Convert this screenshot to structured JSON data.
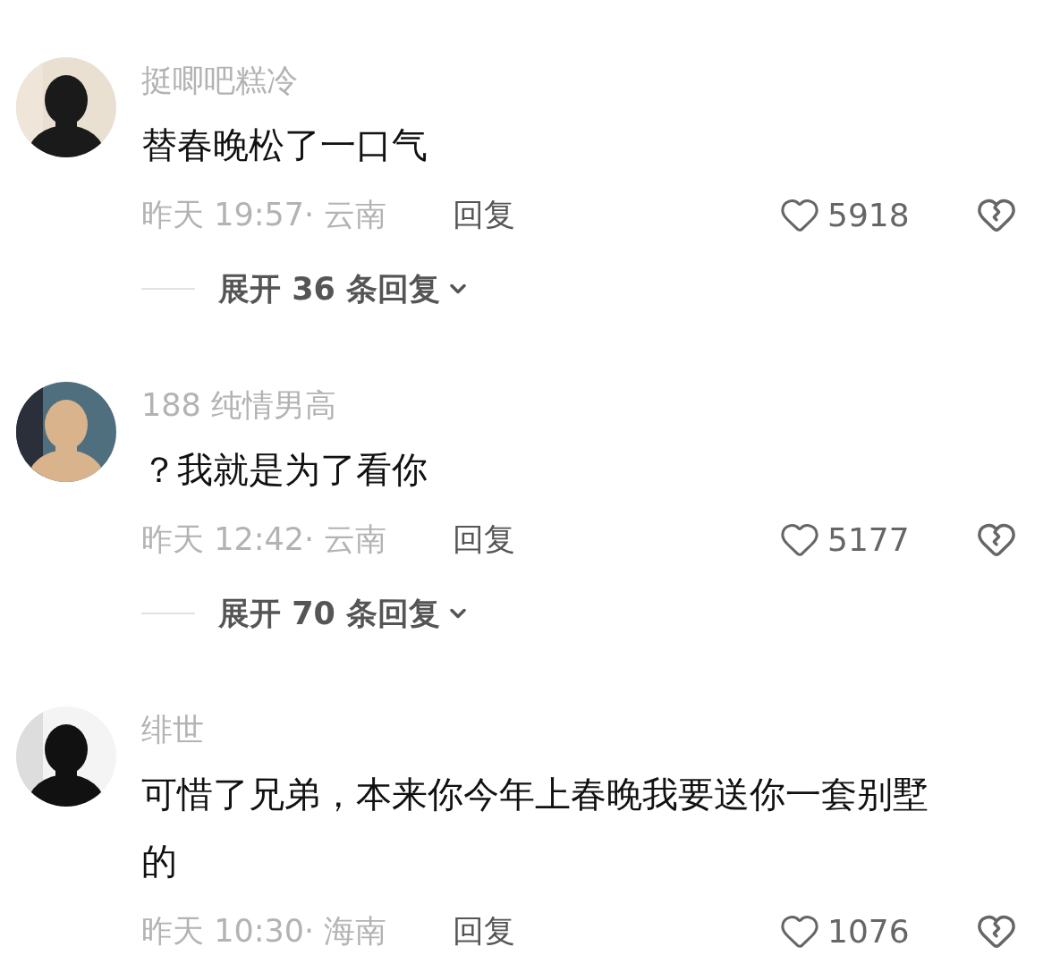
{
  "comments": [
    {
      "username": "挺唧吧糕冷",
      "text": "替春晚松了一口气",
      "meta": "昨天 19:57· 云南",
      "reply": "回复",
      "likes": "5918",
      "expand": "展开 36 条回复"
    },
    {
      "username": "188 纯情男高",
      "text": "？我就是为了看你",
      "meta": "昨天 12:42· 云南",
      "reply": "回复",
      "likes": "5177",
      "expand": "展开 70 条回复"
    },
    {
      "username": "绯世",
      "text": "可惜了兄弟，本来你今年上春晚我要送你一套别墅的",
      "meta": "昨天 10:30· 海南",
      "reply": "回复",
      "likes": "1076"
    }
  ]
}
